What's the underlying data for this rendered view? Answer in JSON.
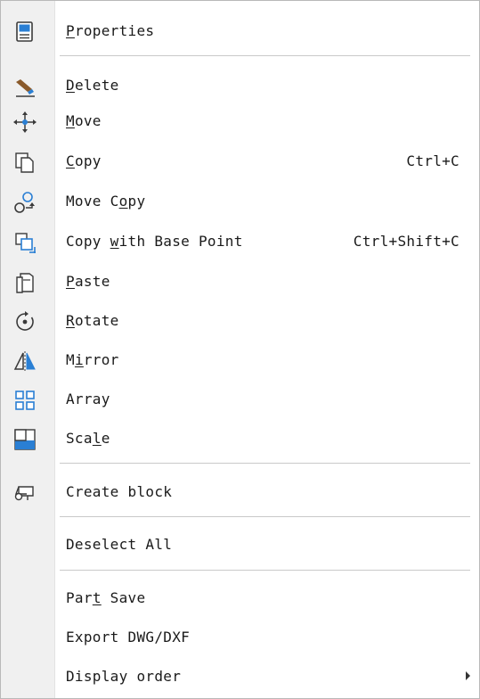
{
  "menu": {
    "items": [
      {
        "id": "properties",
        "pre": "",
        "mn": "P",
        "post": "roperties",
        "shortcut": "",
        "icon": "properties-icon"
      },
      {
        "id": "delete",
        "pre": "",
        "mn": "D",
        "post": "elete",
        "shortcut": "",
        "icon": "eraser-icon"
      },
      {
        "id": "move",
        "pre": "",
        "mn": "M",
        "post": "ove",
        "shortcut": "",
        "icon": "move-arrows-icon"
      },
      {
        "id": "copy",
        "pre": "",
        "mn": "C",
        "post": "opy",
        "shortcut": "Ctrl+C",
        "icon": "copy-icon"
      },
      {
        "id": "move-copy",
        "pre": "Move C",
        "mn": "o",
        "post": "py",
        "shortcut": "",
        "icon": "move-copy-icon"
      },
      {
        "id": "copy-with-base-point",
        "pre": "Copy ",
        "mn": "w",
        "post": "ith Base Point",
        "shortcut": "Ctrl+Shift+C",
        "icon": "copy-base-point-icon"
      },
      {
        "id": "paste",
        "pre": "",
        "mn": "P",
        "post": "aste",
        "shortcut": "",
        "icon": "paste-icon"
      },
      {
        "id": "rotate",
        "pre": "",
        "mn": "R",
        "post": "otate",
        "shortcut": "",
        "icon": "rotate-icon"
      },
      {
        "id": "mirror",
        "pre": "M",
        "mn": "i",
        "post": "rror",
        "shortcut": "",
        "icon": "mirror-icon"
      },
      {
        "id": "array",
        "pre": "Array",
        "mn": "",
        "post": "",
        "shortcut": "",
        "icon": "array-icon"
      },
      {
        "id": "scale",
        "pre": "Sca",
        "mn": "l",
        "post": "e",
        "shortcut": "",
        "icon": "scale-icon"
      },
      {
        "id": "create-block",
        "pre": "Create block",
        "mn": "",
        "post": "",
        "shortcut": "",
        "icon": "create-block-icon"
      },
      {
        "id": "deselect-all",
        "pre": "Deselect All",
        "mn": "",
        "post": "",
        "shortcut": "",
        "icon": ""
      },
      {
        "id": "part-save",
        "pre": "Par",
        "mn": "t",
        "post": " Save",
        "shortcut": "",
        "icon": ""
      },
      {
        "id": "export-dwg-dxf",
        "pre": "Export DWG/DXF",
        "mn": "",
        "post": "",
        "shortcut": "",
        "icon": ""
      },
      {
        "id": "display-order",
        "pre": "Display order",
        "mn": "",
        "post": "",
        "shortcut": "",
        "icon": "",
        "submenu": true
      }
    ]
  },
  "colors": {
    "gutter": "#f0f0f0",
    "separator": "#c9c9c9",
    "icon_blue": "#2a7fd4",
    "icon_dark": "#3a3a3a"
  }
}
